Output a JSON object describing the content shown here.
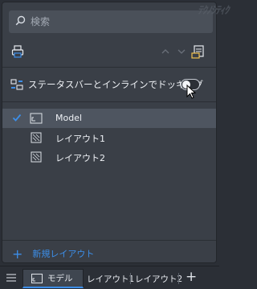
{
  "search": {
    "placeholder": "検索",
    "icon": "search-icon"
  },
  "watermark": {
    "text": "ﾃｸﾉｼﾃｨｸ"
  },
  "toolbar": {
    "print_icon": "printer-icon",
    "up_icon": "chevron-up-icon",
    "down_icon": "chevron-down-icon",
    "page_setup_icon": "page-setup-icon"
  },
  "dock": {
    "label": "ステータスバーとインラインでドッキング",
    "icon": "dock-layout-icon",
    "toggle_on": false
  },
  "layouts": [
    {
      "name": "Model",
      "selected": true,
      "icon": "model-space-icon"
    },
    {
      "name": "レイアウト1",
      "selected": false,
      "icon": "layout-sheet-icon"
    },
    {
      "name": "レイアウト2",
      "selected": false,
      "icon": "layout-sheet-icon"
    }
  ],
  "new_layout": {
    "label": "新規レイアウト",
    "icon": "plus-icon"
  },
  "status_tabs": {
    "menu_icon": "hamburger-menu-icon",
    "tabs": [
      {
        "label": "モデル",
        "active": true
      },
      {
        "label": "レイアウト1",
        "active": false
      },
      {
        "label": "レイアウト2",
        "active": false
      }
    ],
    "add_label": "+"
  },
  "colors": {
    "accent": "#3c8ee8",
    "panel_bg": "#3a3f47",
    "selected_row": "#4e5560"
  }
}
